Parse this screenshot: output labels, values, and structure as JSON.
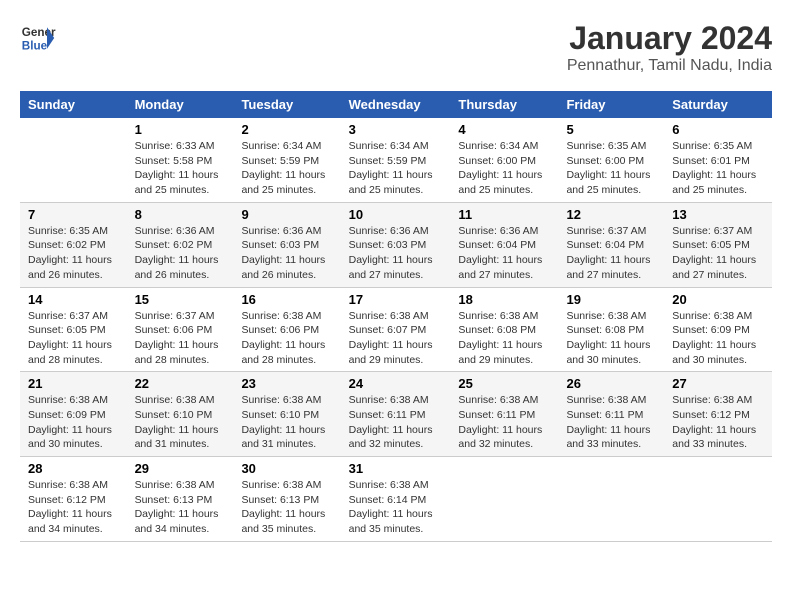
{
  "logo": {
    "line1": "General",
    "line2": "Blue"
  },
  "title": "January 2024",
  "subtitle": "Pennathur, Tamil Nadu, India",
  "header": {
    "days": [
      "Sunday",
      "Monday",
      "Tuesday",
      "Wednesday",
      "Thursday",
      "Friday",
      "Saturday"
    ]
  },
  "weeks": [
    {
      "cells": [
        {
          "day": "",
          "info": ""
        },
        {
          "day": "1",
          "info": "Sunrise: 6:33 AM\nSunset: 5:58 PM\nDaylight: 11 hours\nand 25 minutes."
        },
        {
          "day": "2",
          "info": "Sunrise: 6:34 AM\nSunset: 5:59 PM\nDaylight: 11 hours\nand 25 minutes."
        },
        {
          "day": "3",
          "info": "Sunrise: 6:34 AM\nSunset: 5:59 PM\nDaylight: 11 hours\nand 25 minutes."
        },
        {
          "day": "4",
          "info": "Sunrise: 6:34 AM\nSunset: 6:00 PM\nDaylight: 11 hours\nand 25 minutes."
        },
        {
          "day": "5",
          "info": "Sunrise: 6:35 AM\nSunset: 6:00 PM\nDaylight: 11 hours\nand 25 minutes."
        },
        {
          "day": "6",
          "info": "Sunrise: 6:35 AM\nSunset: 6:01 PM\nDaylight: 11 hours\nand 25 minutes."
        }
      ]
    },
    {
      "cells": [
        {
          "day": "7",
          "info": "Sunrise: 6:35 AM\nSunset: 6:02 PM\nDaylight: 11 hours\nand 26 minutes."
        },
        {
          "day": "8",
          "info": "Sunrise: 6:36 AM\nSunset: 6:02 PM\nDaylight: 11 hours\nand 26 minutes."
        },
        {
          "day": "9",
          "info": "Sunrise: 6:36 AM\nSunset: 6:03 PM\nDaylight: 11 hours\nand 26 minutes."
        },
        {
          "day": "10",
          "info": "Sunrise: 6:36 AM\nSunset: 6:03 PM\nDaylight: 11 hours\nand 27 minutes."
        },
        {
          "day": "11",
          "info": "Sunrise: 6:36 AM\nSunset: 6:04 PM\nDaylight: 11 hours\nand 27 minutes."
        },
        {
          "day": "12",
          "info": "Sunrise: 6:37 AM\nSunset: 6:04 PM\nDaylight: 11 hours\nand 27 minutes."
        },
        {
          "day": "13",
          "info": "Sunrise: 6:37 AM\nSunset: 6:05 PM\nDaylight: 11 hours\nand 27 minutes."
        }
      ]
    },
    {
      "cells": [
        {
          "day": "14",
          "info": "Sunrise: 6:37 AM\nSunset: 6:05 PM\nDaylight: 11 hours\nand 28 minutes."
        },
        {
          "day": "15",
          "info": "Sunrise: 6:37 AM\nSunset: 6:06 PM\nDaylight: 11 hours\nand 28 minutes."
        },
        {
          "day": "16",
          "info": "Sunrise: 6:38 AM\nSunset: 6:06 PM\nDaylight: 11 hours\nand 28 minutes."
        },
        {
          "day": "17",
          "info": "Sunrise: 6:38 AM\nSunset: 6:07 PM\nDaylight: 11 hours\nand 29 minutes."
        },
        {
          "day": "18",
          "info": "Sunrise: 6:38 AM\nSunset: 6:08 PM\nDaylight: 11 hours\nand 29 minutes."
        },
        {
          "day": "19",
          "info": "Sunrise: 6:38 AM\nSunset: 6:08 PM\nDaylight: 11 hours\nand 30 minutes."
        },
        {
          "day": "20",
          "info": "Sunrise: 6:38 AM\nSunset: 6:09 PM\nDaylight: 11 hours\nand 30 minutes."
        }
      ]
    },
    {
      "cells": [
        {
          "day": "21",
          "info": "Sunrise: 6:38 AM\nSunset: 6:09 PM\nDaylight: 11 hours\nand 30 minutes."
        },
        {
          "day": "22",
          "info": "Sunrise: 6:38 AM\nSunset: 6:10 PM\nDaylight: 11 hours\nand 31 minutes."
        },
        {
          "day": "23",
          "info": "Sunrise: 6:38 AM\nSunset: 6:10 PM\nDaylight: 11 hours\nand 31 minutes."
        },
        {
          "day": "24",
          "info": "Sunrise: 6:38 AM\nSunset: 6:11 PM\nDaylight: 11 hours\nand 32 minutes."
        },
        {
          "day": "25",
          "info": "Sunrise: 6:38 AM\nSunset: 6:11 PM\nDaylight: 11 hours\nand 32 minutes."
        },
        {
          "day": "26",
          "info": "Sunrise: 6:38 AM\nSunset: 6:11 PM\nDaylight: 11 hours\nand 33 minutes."
        },
        {
          "day": "27",
          "info": "Sunrise: 6:38 AM\nSunset: 6:12 PM\nDaylight: 11 hours\nand 33 minutes."
        }
      ]
    },
    {
      "cells": [
        {
          "day": "28",
          "info": "Sunrise: 6:38 AM\nSunset: 6:12 PM\nDaylight: 11 hours\nand 34 minutes."
        },
        {
          "day": "29",
          "info": "Sunrise: 6:38 AM\nSunset: 6:13 PM\nDaylight: 11 hours\nand 34 minutes."
        },
        {
          "day": "30",
          "info": "Sunrise: 6:38 AM\nSunset: 6:13 PM\nDaylight: 11 hours\nand 35 minutes."
        },
        {
          "day": "31",
          "info": "Sunrise: 6:38 AM\nSunset: 6:14 PM\nDaylight: 11 hours\nand 35 minutes."
        },
        {
          "day": "",
          "info": ""
        },
        {
          "day": "",
          "info": ""
        },
        {
          "day": "",
          "info": ""
        }
      ]
    }
  ]
}
